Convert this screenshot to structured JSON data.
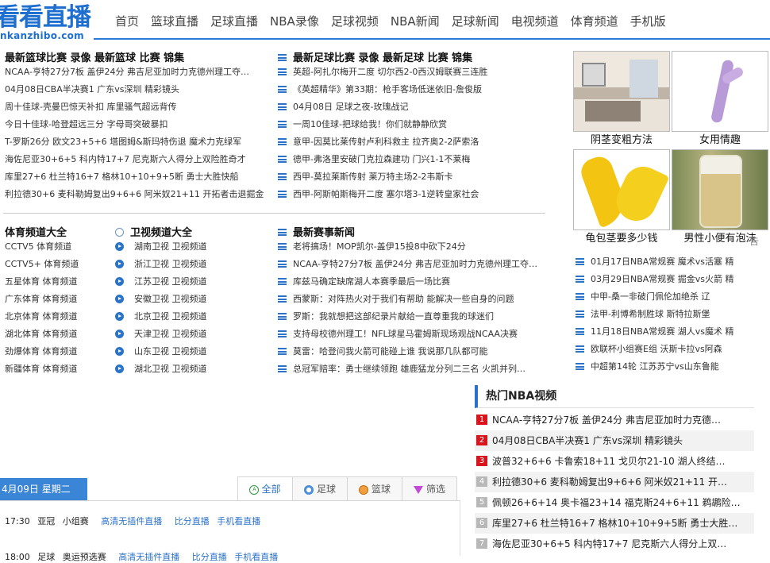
{
  "logo": {
    "main": "看看直播",
    "sub": "nkanzhibo.com"
  },
  "nav": [
    "首页",
    "篮球直播",
    "足球直播",
    "NBA录像",
    "足球视频",
    "NBA新闻",
    "足球新闻",
    "电视频道",
    "体育频道",
    "手机版"
  ],
  "basketball": {
    "title": "最新篮球比赛  录像    最新篮球  比赛  锦集",
    "items": [
      "NCAA-亨特27分7板 盖伊24分 弗吉尼亚加时力克德州理工夺…",
      "04月08日CBA半决赛1 广东vs深圳 精彩镜头",
      "周十佳球-壳曼巴惊天补扣 库里骚气超远背传",
      "今日十佳球-哈登超远三分 字母哥突破暴扣",
      "T-罗斯26分 欧文23+5+6 塔图姆&斯玛特伤退 魔术力克绿军",
      "海佐尼亚30+6+5 科内特17+7 尼克斯六人得分上双险胜奇才",
      "库里27+6 杜兰特16+7 格林10+10+9+5断 勇士大胜快船",
      "利拉德30+6 麦科勒姆复出9+6+6 阿米奴21+11 开拓者击退掘金"
    ]
  },
  "football": {
    "title": "最新足球比赛  录像    最新足球  比赛  锦集",
    "items": [
      "英超-阿扎尔梅开二度 切尔西2-0西汉姆联赛三连胜",
      "《英超精华》第33期：枪手客场低迷依旧-詹俊版",
      "04月08日 足球之夜-玫瑰战记",
      "一周10佳球-把球给我！你们就静静欣赏",
      "意甲-因莫比莱传射卢利科救主 拉齐奥2-2萨索洛",
      "德甲-弗洛里安破门克拉森建功 门兴1-1不莱梅",
      "西甲-莫拉莱斯传射 莱万特主场2-2韦斯卡",
      "西甲-阿斯帕斯梅开二度 塞尔塔3-1逆转皇家社会"
    ]
  },
  "sports_channels": {
    "title": "体育频道大全",
    "items": [
      "CCTV5 体育频道",
      "CCTV5+ 体育频道",
      "五星体育 体育频道",
      "广东体育 体育频道",
      "北京体育 体育频道",
      "湖北体育 体育频道",
      "劲爆体育 体育频道",
      "新疆体育 体育频道"
    ]
  },
  "tv_channels": {
    "title": "卫视频道大全",
    "items": [
      "湖南卫视 卫视频道",
      "浙江卫视 卫视频道",
      "江苏卫视 卫视频道",
      "安徽卫视 卫视频道",
      "北京卫视 卫视频道",
      "天津卫视 卫视频道",
      "山东卫视 卫视频道",
      "湖北卫视 卫视频道"
    ]
  },
  "news": {
    "title": "最新赛事新闻",
    "items": [
      "老将搞场！MOP凯尔-盖伊15投8中砍下24分",
      "NCAA-亨特27分7板 盖伊24分 弗吉尼亚加时力克德州理工夺…",
      "库兹马确定缺席湖人本赛季最后一场比赛",
      "西蒙斯：对阵热火对于我们有帮助 能解决一些自身的问题",
      "罗斯：我就想把这部纪录片献给一直尊重我的球迷们",
      "支持母校德州理工！NFL球星马霍姆斯现场观战NCAA决赛",
      "莫雷：哈登问我火箭可能碰上谁 我说那几队都可能",
      "总冠军赔率：勇士继续领跑 雄鹿猛龙分列二三名 火凯并列…"
    ]
  },
  "ads": [
    "阴茎变粗方法",
    "女用情趣",
    "龟包茎要多少钱",
    "男性小便有泡沫"
  ],
  "right_list": [
    "01月17日NBA常规赛 魔术vs活塞 精",
    "03月29日NBA常规赛 掘金vs火箭 精",
    "中甲-桑一非破门佩伦加绝杀 辽",
    "法甲-利博希制胜球 斯特拉斯堡",
    "11月18日NBA常规赛 湖人vs魔术 精",
    "欧联杯小组赛E组 沃斯卡拉vs阿森",
    "中超第14轮 江苏苏宁vs山东鲁能"
  ],
  "partial_text": "告",
  "hot_nba": {
    "title": "热门NBA视频",
    "items": [
      {
        "n": "1",
        "text": "NCAA-亨特27分7板 盖伊24分 弗吉尼亚加时力克德…"
      },
      {
        "n": "2",
        "text": "04月08日CBA半决赛1 广东vs深圳 精彩镜头"
      },
      {
        "n": "3",
        "text": "波普32+6+6 卡鲁索18+11 戈贝尔21-10 湖人终结…"
      },
      {
        "n": "4",
        "text": "利拉德30+6 麦科勒姆复出9+6+6 阿米奴21+11 开…"
      },
      {
        "n": "5",
        "text": "佩顿26+6+14 奥卡福23+14 福克斯24+6+11 鹈鹕险…"
      },
      {
        "n": "6",
        "text": "库里27+6 杜兰特16+7 格林10+10+9+5断 勇士大胜…"
      },
      {
        "n": "7",
        "text": "海佐尼亚30+6+5 科内特17+7 尼克斯六人得分上双…"
      }
    ]
  },
  "schedule": {
    "date": "4月09日  星期二",
    "tabs": [
      "全部",
      "足球",
      "篮球",
      "筛选"
    ],
    "rows": [
      {
        "time": "17:30",
        "league": "亚冠",
        "teams": "小组赛",
        "links": [
          "高清无插件直播",
          "比分直播",
          "手机看直播"
        ]
      },
      {
        "time": "18:00",
        "league": "足球",
        "teams": "奥运预选赛",
        "links": [
          "高清无插件直播",
          "比分直播",
          "手机看直播"
        ]
      }
    ]
  }
}
